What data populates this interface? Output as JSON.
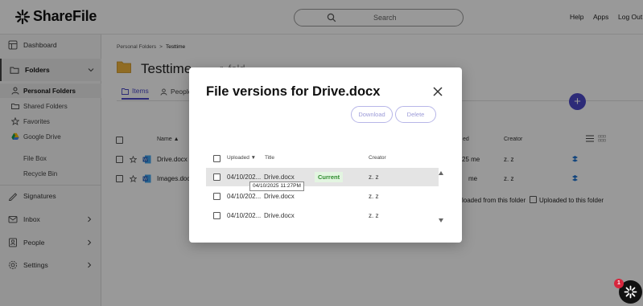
{
  "header": {
    "logo_text": "ShareFile",
    "search_placeholder": "Search",
    "help_label": "Help",
    "apps_label": "Apps",
    "logout_label": "Log Out"
  },
  "sidebar": {
    "dashboard": "Dashboard",
    "folders": "Folders",
    "personal_folders": "Personal Folders",
    "shared_folders": "Shared Folders",
    "favorites": "Favorites",
    "google_drive": "Google Drive",
    "file_box": "File Box",
    "recycle_bin": "Recycle Bin",
    "signatures": "Signatures",
    "inbox": "Inbox",
    "people": "People",
    "settings": "Settings"
  },
  "main": {
    "breadcrumb_root": "Personal Folders",
    "breadcrumb_sep": ">",
    "breadcrumb_current": "Testtime",
    "title": "Testtime",
    "title_rest": "...r. fold",
    "tab_items": "Items",
    "tab_people": "People",
    "col_name": "Name ▲",
    "col_modified": "ed",
    "col_creator": "Creator",
    "rows": [
      {
        "name": "Drive.docx",
        "modified": "25 me",
        "creator": "z. z"
      },
      {
        "name": "Images.doc",
        "modified": "me",
        "creator": "z. z"
      }
    ],
    "filter_downloaded": "loaded from this folder",
    "filter_uploaded": "Uploaded to this folder"
  },
  "modal": {
    "title": "File versions for Drive.docx",
    "download_label": "Download",
    "delete_label": "Delete",
    "col_uploaded": "Uploaded ▼",
    "col_title": "Title",
    "col_creator": "Creator",
    "current_badge": "Current",
    "tooltip": "04/10/2025 11:27PM",
    "versions": [
      {
        "uploaded": "04/10/202...",
        "title": "Drive.docx",
        "creator": "z. z"
      },
      {
        "uploaded": "04/10/202...",
        "title": "Drive.docx",
        "creator": "z. z"
      },
      {
        "uploaded": "04/10/202...",
        "title": "Drive.docx",
        "creator": "z. z"
      }
    ]
  },
  "help": {
    "badge_count": "1"
  },
  "colors": {
    "accent": "#4b49c8",
    "current_badge_bg": "#e3f5e1",
    "current_badge_text": "#2b8a2b",
    "overlay": "rgba(0,0,0,0.4)"
  }
}
